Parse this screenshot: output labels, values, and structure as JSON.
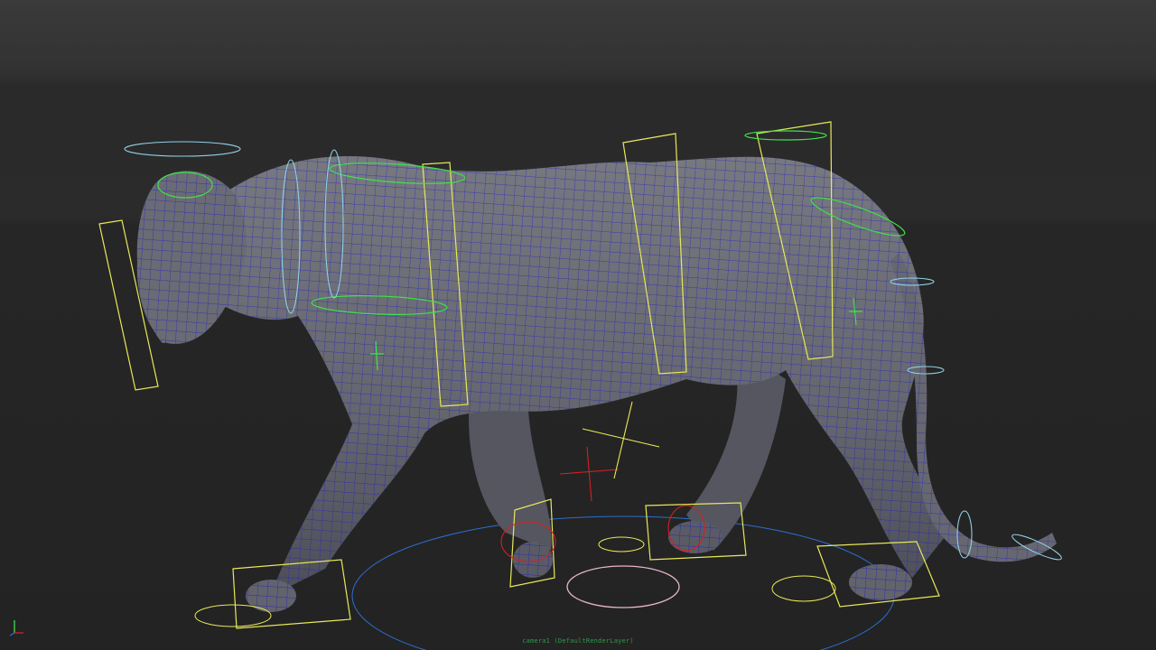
{
  "viewport": {
    "camera_label": "camera1  (DefaultRenderLayer)",
    "colors": {
      "background_top": "#3a3a3a",
      "background_floor": "#232323",
      "mesh_fill": "#6a6b74",
      "wireframe": "#1c1cc8",
      "control_yellow": "#e8e85a",
      "control_green": "#3fe24a",
      "control_blue": "#2b6fd1",
      "control_cyan": "#8fd0e6",
      "control_red": "#d62020",
      "control_pink": "#e8b8c0"
    },
    "icons": {
      "axis": "axis-gizmo-icon"
    }
  }
}
